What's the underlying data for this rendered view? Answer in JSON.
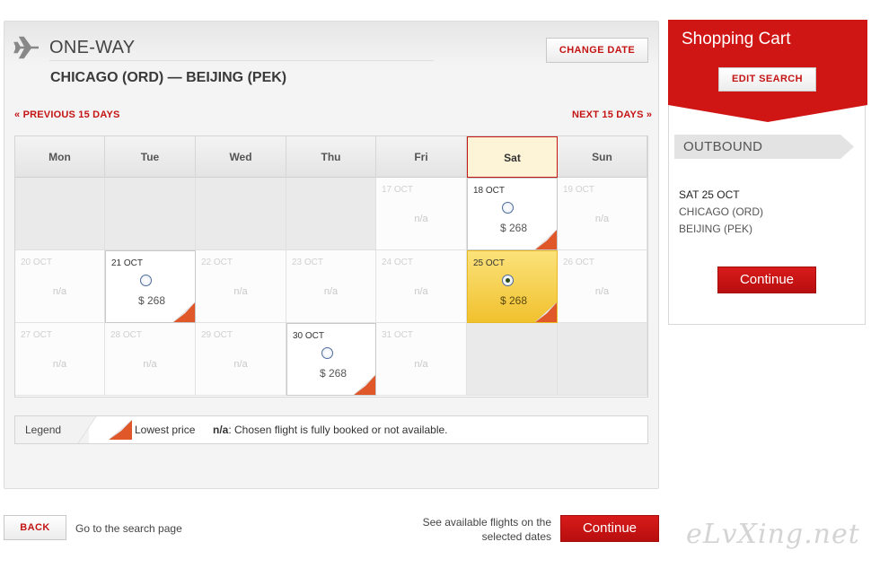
{
  "header": {
    "trip_type": "ONE-WAY",
    "route": "CHICAGO (ORD) — BEIJING (PEK)",
    "change_date": "CHANGE DATE"
  },
  "nav": {
    "prev": "«  PREVIOUS 15 DAYS",
    "next": "NEXT 15 DAYS  »"
  },
  "calendar": {
    "days": [
      "Mon",
      "Tue",
      "Wed",
      "Thu",
      "Fri",
      "Sat",
      "Sun"
    ],
    "selected_day": "Sat",
    "weeks": [
      [
        {
          "state": "empty"
        },
        {
          "state": "empty"
        },
        {
          "state": "empty"
        },
        {
          "state": "empty"
        },
        {
          "state": "na",
          "date": "17 OCT",
          "text": "n/a"
        },
        {
          "state": "avail",
          "date": "18 OCT",
          "price": "$ 268",
          "lowest": true
        },
        {
          "state": "na",
          "date": "19 OCT",
          "text": "n/a"
        }
      ],
      [
        {
          "state": "na",
          "date": "20 OCT",
          "text": "n/a"
        },
        {
          "state": "avail",
          "date": "21 OCT",
          "price": "$ 268",
          "lowest": true
        },
        {
          "state": "na",
          "date": "22 OCT",
          "text": "n/a"
        },
        {
          "state": "na",
          "date": "23 OCT",
          "text": "n/a"
        },
        {
          "state": "na",
          "date": "24 OCT",
          "text": "n/a"
        },
        {
          "state": "selected",
          "date": "25 OCT",
          "price": "$ 268",
          "lowest": true
        },
        {
          "state": "na",
          "date": "26 OCT",
          "text": "n/a"
        }
      ],
      [
        {
          "state": "na",
          "date": "27 OCT",
          "text": "n/a"
        },
        {
          "state": "na",
          "date": "28 OCT",
          "text": "n/a"
        },
        {
          "state": "na",
          "date": "29 OCT",
          "text": "n/a"
        },
        {
          "state": "avail",
          "date": "30 OCT",
          "price": "$ 268",
          "lowest": true
        },
        {
          "state": "na",
          "date": "31 OCT",
          "text": "n/a"
        },
        {
          "state": "empty"
        },
        {
          "state": "empty"
        }
      ]
    ]
  },
  "legend": {
    "label": "Legend",
    "lowest_price": "Lowest price",
    "na_term": "n/a",
    "na_desc": ": Chosen flight is fully booked or not available."
  },
  "footer": {
    "back": "BACK",
    "back_text": "Go to the search page",
    "see_line1": "See available flights on the",
    "see_line2": "selected dates",
    "continue": "Continue"
  },
  "cart": {
    "title": "Shopping Cart",
    "edit_search": "EDIT SEARCH",
    "outbound": "OUTBOUND",
    "date": "SAT 25 OCT",
    "from": "CHICAGO (ORD)",
    "to": "BEIJING (PEK)",
    "continue": "Continue"
  },
  "watermark": "eLvXing.net",
  "colors": {
    "brand_red": "#c41414",
    "selected_yellow": "#f1c12e",
    "corner_orange": "#e0572a"
  }
}
